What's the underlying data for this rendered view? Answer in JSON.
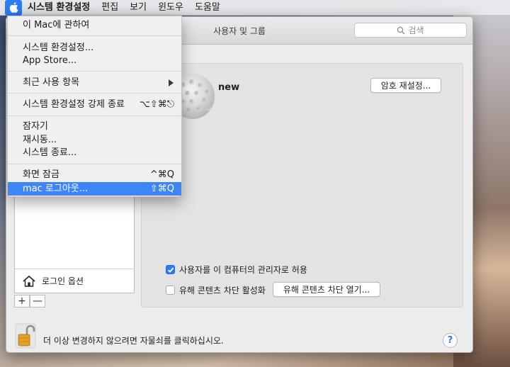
{
  "menubar": {
    "app_name": "시스템 환경설정",
    "items": [
      "편집",
      "보기",
      "윈도우",
      "도움말"
    ]
  },
  "window": {
    "title": "사용자 및 그룹",
    "search_placeholder": "검색"
  },
  "apple_menu": {
    "about": "이 Mac에 관하여",
    "system_prefs": "시스템 환경설정...",
    "app_store": "App Store...",
    "recent_items": "최근 사용 항목",
    "force_quit": "시스템 환경설정 강제 종료",
    "force_quit_shortcut": "⌥⇧⌘⎋",
    "sleep": "잠자기",
    "restart": "재시동...",
    "shutdown": "시스템 종료...",
    "lock_screen": "화면 잠금",
    "lock_screen_shortcut": "^⌘Q",
    "logout": "mac 로그아웃...",
    "logout_shortcut": "⇧⌘Q"
  },
  "sidebar": {
    "login_options_label": "로그인 옵션",
    "add_label": "+",
    "remove_label": "—"
  },
  "user": {
    "name": "new",
    "reset_password_label": "암호 재설정...",
    "admin_checkbox_label": "사용자를 이 컴퓨터의 관리자로 허용",
    "admin_checked": true,
    "parental_checkbox_label": "유해 콘텐츠 차단 활성화",
    "parental_checked": false,
    "parental_button_label": "유해 콘텐츠 차단 열기..."
  },
  "footer": {
    "lock_text": "더 이상 변경하지 않으려면 자물쇠를 클릭하십시오.",
    "help_label": "?"
  },
  "colors": {
    "accent": "#2d7cf5",
    "menu_highlight": "#3e85f5"
  }
}
